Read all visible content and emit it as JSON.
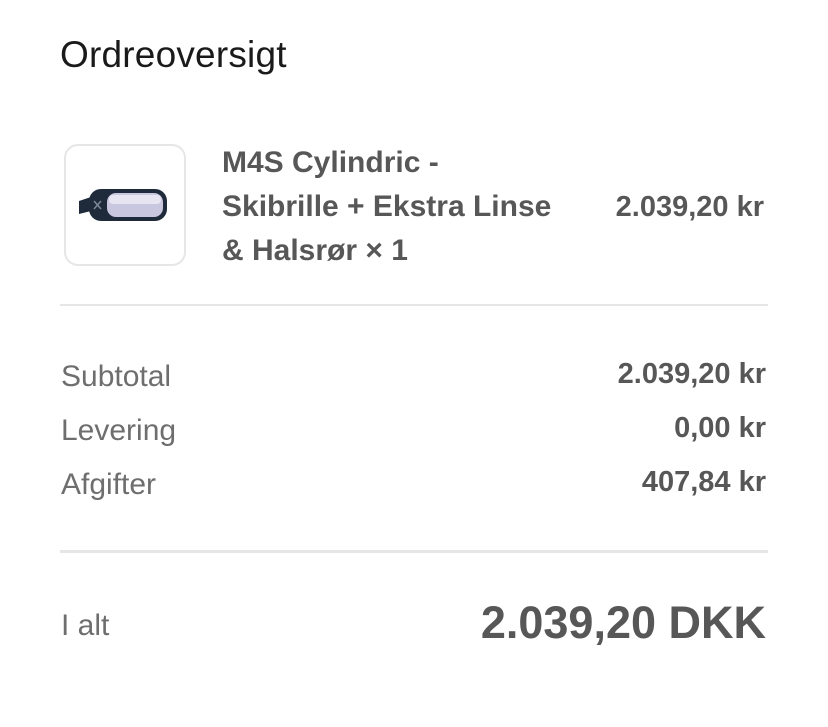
{
  "summary": {
    "title": "Ordreoversigt"
  },
  "item": {
    "name": "M4S Cylindric - Skibrille + Ekstra Linse & Halsrør",
    "quantity_label": "× 1",
    "price": "2.039,20 kr",
    "image_icon": "ski-goggles-icon"
  },
  "breakdown": {
    "subtotal_label": "Subtotal",
    "subtotal_value": "2.039,20 kr",
    "delivery_label": "Levering",
    "delivery_value": "0,00 kr",
    "taxes_label": "Afgifter",
    "taxes_value": "407,84 kr"
  },
  "total": {
    "label": "I alt",
    "value": "2.039,20 DKK"
  }
}
